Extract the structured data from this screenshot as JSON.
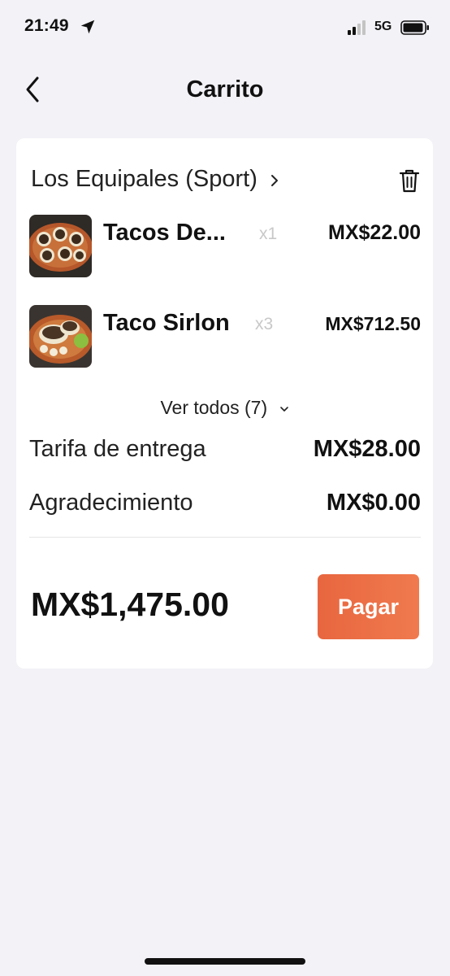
{
  "status_bar": {
    "time": "21:49",
    "network": "5G",
    "icons": [
      "location-arrow-icon",
      "cellular-signal-icon",
      "battery-icon"
    ]
  },
  "header": {
    "title": "Carrito",
    "back_icon": "chevron-left-icon"
  },
  "cart": {
    "store_name": "Los Equipales (Sport)",
    "store_icons": [
      "chevron-right-icon",
      "trash-icon"
    ],
    "items": [
      {
        "name": "Tacos De...",
        "quantity": "x1",
        "price": "MX$22.00",
        "thumbnail": "tacos-plate-photo"
      },
      {
        "name": "Taco Sirlon",
        "quantity": "x3",
        "price": "MX$712.50",
        "thumbnail": "taco-sirlon-photo"
      }
    ],
    "view_all": "Ver todos (7)",
    "fees": [
      {
        "label": "Tarifa de entrega",
        "value": "MX$28.00"
      },
      {
        "label": "Agradecimiento",
        "value": "MX$0.00"
      }
    ],
    "total": "MX$1,475.00",
    "pay_label": "Pagar"
  },
  "colors": {
    "background": "#f2f2f7",
    "card": "#ffffff",
    "accent": "#ec6d45",
    "muted_text": "#c8c8c8"
  }
}
